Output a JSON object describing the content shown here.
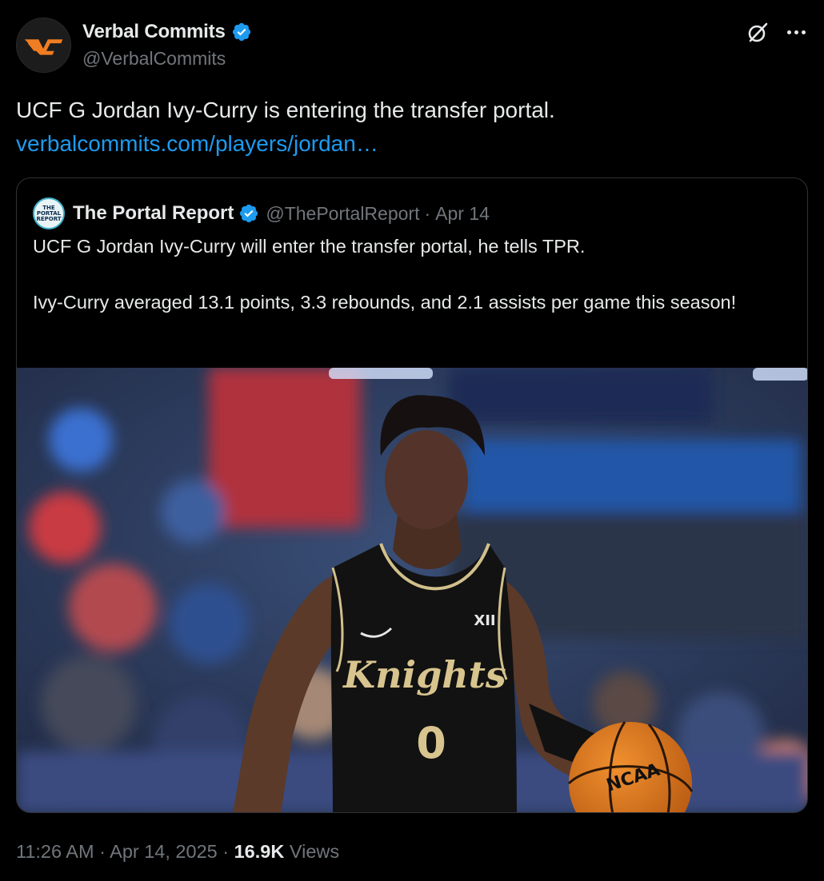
{
  "author": {
    "name": "Verbal Commits",
    "handle": "@VerbalCommits",
    "avatar_icon": "vc-logo-icon",
    "verified": true
  },
  "actions": {
    "grok_icon": "grok-icon",
    "more_icon": "more-options-icon"
  },
  "tweet": {
    "text": "UCF G Jordan Ivy-Curry is entering the transfer portal.",
    "link": "verbalcommits.com/players/jordan…"
  },
  "quote": {
    "name": "The Portal Report",
    "handle": "@ThePortalReport",
    "separator": "·",
    "date": "Apr 14",
    "avatar_label": "THE PORTAL REPORT",
    "text": "UCF G Jordan Ivy-Curry will enter the transfer portal, he tells TPR.\n\nIvy-Curry averaged 13.1 points, 3.3 rebounds, and 2.1 assists per game this season!",
    "photo": {
      "jersey_text": "Knights",
      "jersey_number": "0",
      "conference_logo": "XII",
      "ball_text": "NCAA"
    }
  },
  "meta": {
    "time": "11:26 AM",
    "sep1": "·",
    "date": "Apr 14, 2025",
    "sep2": "·",
    "views_count": "16.9K",
    "views_label": "Views"
  },
  "colors": {
    "accent": "#1d9bf0",
    "muted": "#71767b",
    "text": "#e7e9ea",
    "border": "#2f3336",
    "logo_orange": "#f07d22"
  }
}
